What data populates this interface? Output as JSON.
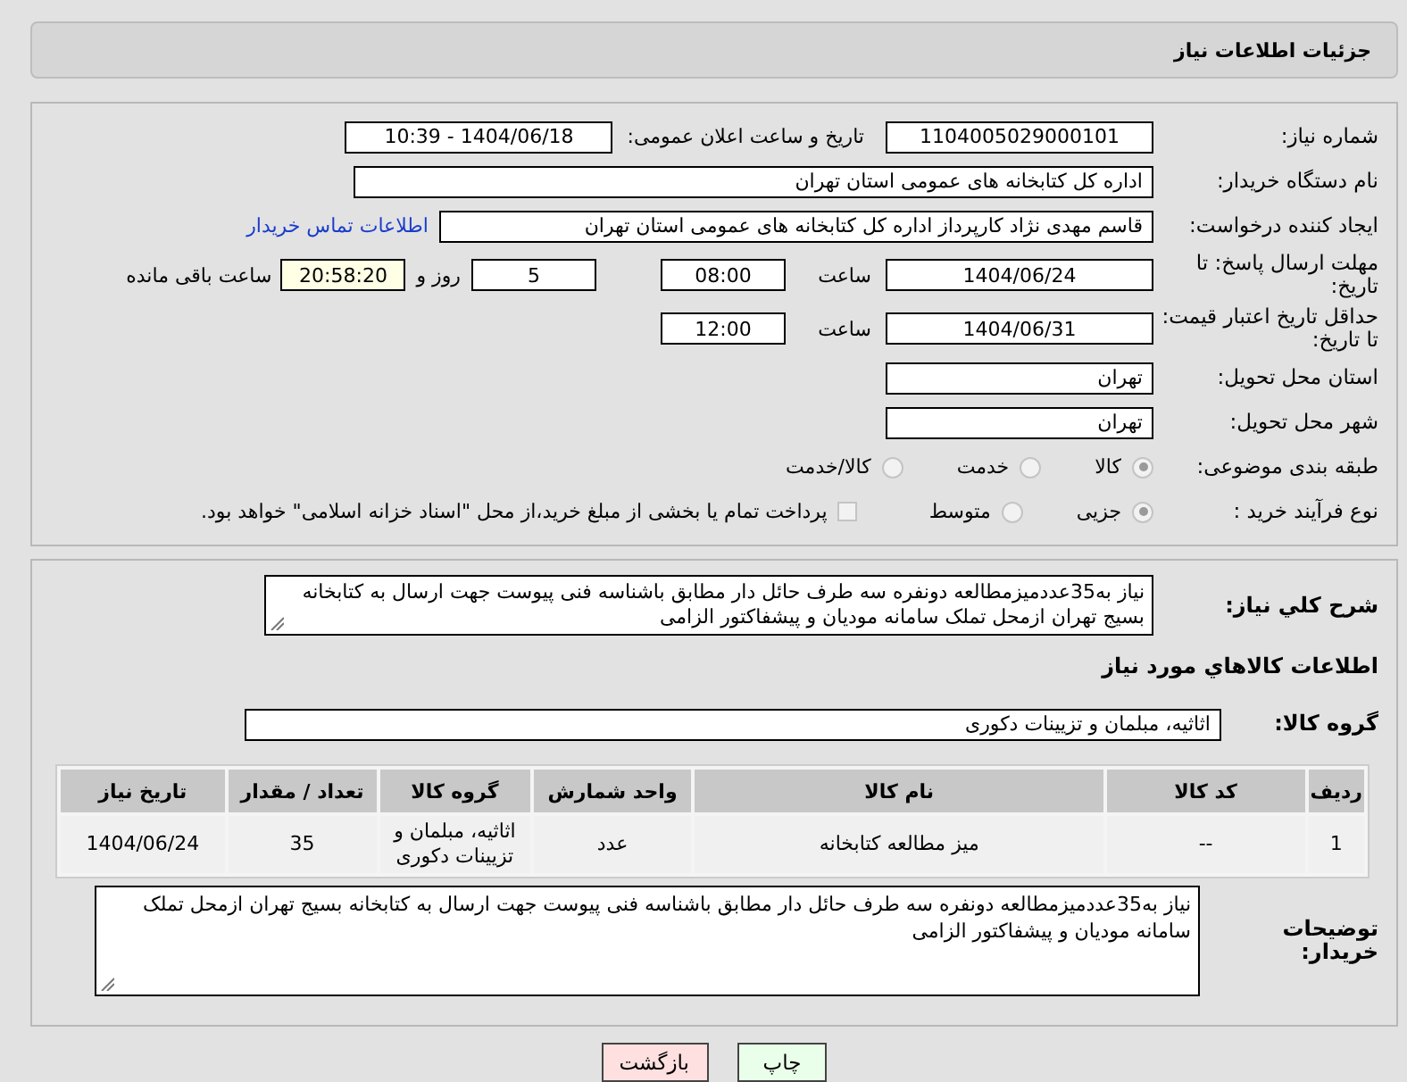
{
  "page_title": "جزئیات اطلاعات نیاز",
  "need_number": {
    "label": "شماره نیاز:",
    "value": "1104005029000101"
  },
  "announce_datetime": {
    "label": "تاریخ و ساعت اعلان عمومی:",
    "value": "1404/06/18 - 10:39"
  },
  "buyer_org": {
    "label": "نام دستگاه خریدار:",
    "value": "اداره کل کتابخانه های عمومی استان تهران"
  },
  "requester": {
    "label": "ایجاد کننده درخواست:",
    "value": "قاسم مهدی نژاد کارپرداز اداره کل کتابخانه های عمومی استان تهران",
    "link": "اطلاعات تماس خریدار"
  },
  "response_deadline": {
    "label": "مهلت ارسال پاسخ: تا تاریخ:",
    "date": "1404/06/24",
    "time_label": "ساعت",
    "time": "08:00",
    "days": "5",
    "days_label": "روز و",
    "remaining": "20:58:20",
    "remaining_label": "ساعت باقی مانده"
  },
  "price_validity": {
    "label": "حداقل تاریخ اعتبار قیمت: تا تاریخ:",
    "date": "1404/06/31",
    "time_label": "ساعت",
    "time": "12:00"
  },
  "delivery_province": {
    "label": "استان محل تحویل:",
    "value": "تهران"
  },
  "delivery_city": {
    "label": "شهر محل تحویل:",
    "value": "تهران"
  },
  "category": {
    "label": "طبقه بندی موضوعی:",
    "options": [
      {
        "label": "کالا",
        "selected": true
      },
      {
        "label": "خدمت",
        "selected": false
      },
      {
        "label": "کالا/خدمت",
        "selected": false
      }
    ]
  },
  "purchase_process": {
    "label": "نوع فرآیند خرید :",
    "options": [
      {
        "label": "جزیی",
        "selected": true
      },
      {
        "label": "متوسط",
        "selected": false
      }
    ],
    "treasury": {
      "label": "پرداخت تمام یا بخشی از مبلغ خرید،از محل \"اسناد خزانه اسلامی\" خواهد بود.",
      "checked": false
    }
  },
  "description": {
    "label": "شرح کلي نياز:",
    "value": "نیاز به35عددمیزمطالعه دونفره سه طرف حائل دار مطابق باشناسه فنی پیوست جهت ارسال به کتابخانه بسیج تهران ازمحل تملک سامانه مودیان و پیشفاکتور الزامی"
  },
  "goods_heading": "اطلاعات کالاهاي مورد نياز",
  "goods_group": {
    "label": "گروه کالا:",
    "value": "اثاثیه، مبلمان و تزیینات دکوری"
  },
  "table": {
    "columns": [
      "ردیف",
      "کد کالا",
      "نام کالا",
      "واحد شمارش",
      "گروه کالا",
      "تعداد / مقدار",
      "تاریخ نیاز"
    ],
    "rows": [
      [
        "1",
        "--",
        "میز مطالعه کتابخانه",
        "عدد",
        "اثاثیه، مبلمان و تزیینات دکوری",
        "35",
        "1404/06/24"
      ]
    ]
  },
  "buyer_notes": {
    "label": "توضیحات خریدار:",
    "value": "نیاز به35عددمیزمطالعه دونفره سه طرف حائل دار مطابق باشناسه فنی پیوست جهت ارسال به کتابخانه بسیج تهران ازمحل تملک سامانه مودیان و پیشفاکتور الزامی"
  },
  "buttons": [
    {
      "label": "چاپ",
      "kind": "print"
    },
    {
      "label": "بازگشت",
      "kind": "back"
    }
  ]
}
